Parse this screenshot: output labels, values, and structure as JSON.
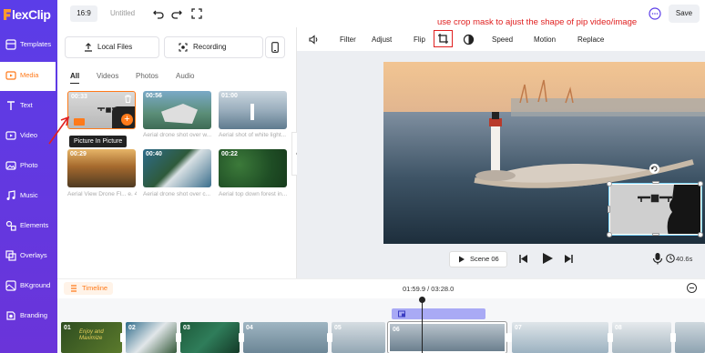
{
  "app": {
    "logo_text": "lexClip",
    "logo_initial": "F"
  },
  "sidebar": {
    "items": [
      {
        "label": "Templates"
      },
      {
        "label": "Media"
      },
      {
        "label": "Text"
      },
      {
        "label": "Video"
      },
      {
        "label": "Photo"
      },
      {
        "label": "Music"
      },
      {
        "label": "Elements"
      },
      {
        "label": "Overlays"
      },
      {
        "label": "BKground"
      },
      {
        "label": "Branding"
      }
    ]
  },
  "topbar": {
    "ratio": "16:9",
    "title": "Untitled",
    "save_label": "Save"
  },
  "annotation": "use crop mask to ajust the shape of pip video/image",
  "media_panel": {
    "local_files_label": "Local Files",
    "recording_label": "Recording",
    "tabs": [
      "All",
      "Videos",
      "Photos",
      "Audio"
    ],
    "tooltip": "Picture In Picture",
    "items": [
      {
        "duration": "00:33",
        "caption": ""
      },
      {
        "duration": "00:56",
        "caption": "Aerial drone shot over w..."
      },
      {
        "duration": "01:00",
        "caption": "Aerial shot of white light..."
      },
      {
        "duration": "00:29",
        "caption": "Aerial View Drone Fl... e. 4K"
      },
      {
        "duration": "00:40",
        "caption": "Aerial drone shot over c..."
      },
      {
        "duration": "00:22",
        "caption": "Aerial top down forest in..."
      }
    ]
  },
  "edit_toolbar": {
    "filter": "Filter",
    "adjust": "Adjust",
    "flip": "Flip",
    "speed": "Speed",
    "motion": "Motion",
    "replace": "Replace"
  },
  "player": {
    "scene_label": "Scene 06",
    "duration_small": "40.6s"
  },
  "timeline": {
    "label": "Timeline",
    "time": "01:59.9 / 03:28.0",
    "clips": [
      {
        "num": "01",
        "text": "Enjoy and Maximize"
      },
      {
        "num": "02",
        "text": ""
      },
      {
        "num": "03",
        "text": ""
      },
      {
        "num": "04",
        "text": ""
      },
      {
        "num": "05",
        "text": ""
      },
      {
        "num": "06",
        "text": ""
      },
      {
        "num": "07",
        "text": ""
      },
      {
        "num": "08",
        "text": ""
      }
    ]
  },
  "colors": {
    "sidebar": "#5b3de8",
    "accent": "#ff7a1a",
    "annotation": "#e02020",
    "pip_track": "#a9aaf5"
  }
}
